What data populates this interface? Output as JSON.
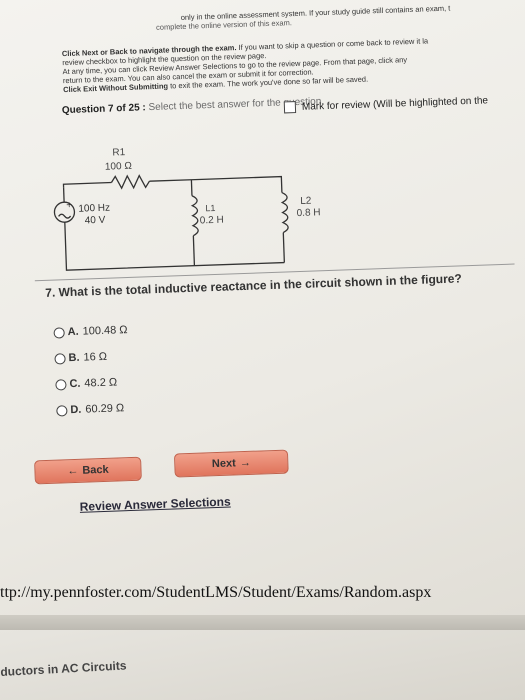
{
  "header": {
    "line1": "only in the online assessment system. If your study guide still contains an exam, t",
    "line2": "complete the online version of this exam."
  },
  "instructions": [
    {
      "bold": "Click Next or Back to navigate through the exam.",
      "rest": " If you want to skip a question or come back to review it la"
    },
    {
      "bold": "",
      "rest": "review checkbox to highlight the question on the review page."
    },
    {
      "bold": "",
      "rest": "At any time, you can click Review Answer Selections to go to the review page. From that page, click any"
    },
    {
      "bold": "",
      "rest": "return to the exam. You can also cancel the exam or submit it for correction."
    },
    {
      "bold": "Click Exit Without Submitting",
      "rest": " to exit the exam. The work you've done so far will be saved."
    }
  ],
  "question_header": {
    "label": "Question 7 of 25 :",
    "instruction": "Select the best answer for the question."
  },
  "review_label": "Mark for review (Will be highlighted on the",
  "circuit": {
    "r1_label": "R1",
    "r1_value": "100 Ω",
    "source_freq": "100 Hz",
    "source_volt": "40 V",
    "source_symbol": "+",
    "l1_label": "L1",
    "l1_value": "0.2 H",
    "l2_label": "L2",
    "l2_value": "0.8 H"
  },
  "question_text": "7.  What is the total inductive reactance in the circuit shown in the figure?",
  "options": [
    {
      "letter": "A.",
      "text": "100.48 Ω"
    },
    {
      "letter": "B.",
      "text": "16 Ω"
    },
    {
      "letter": "C.",
      "text": "48.2 Ω"
    },
    {
      "letter": "D.",
      "text": "60.29 Ω"
    }
  ],
  "buttons": {
    "back_label": "Back",
    "back_arrow": "←",
    "next_label": "Next",
    "next_arrow": "→"
  },
  "review_link": "Review Answer Selections",
  "url": "ttp://my.pennfoster.com/StudentLMS/Student/Exams/Random.aspx",
  "footer": "ductors in AC Circuits",
  "colors": {
    "button": "#e0755d",
    "paper": "#efede8"
  }
}
